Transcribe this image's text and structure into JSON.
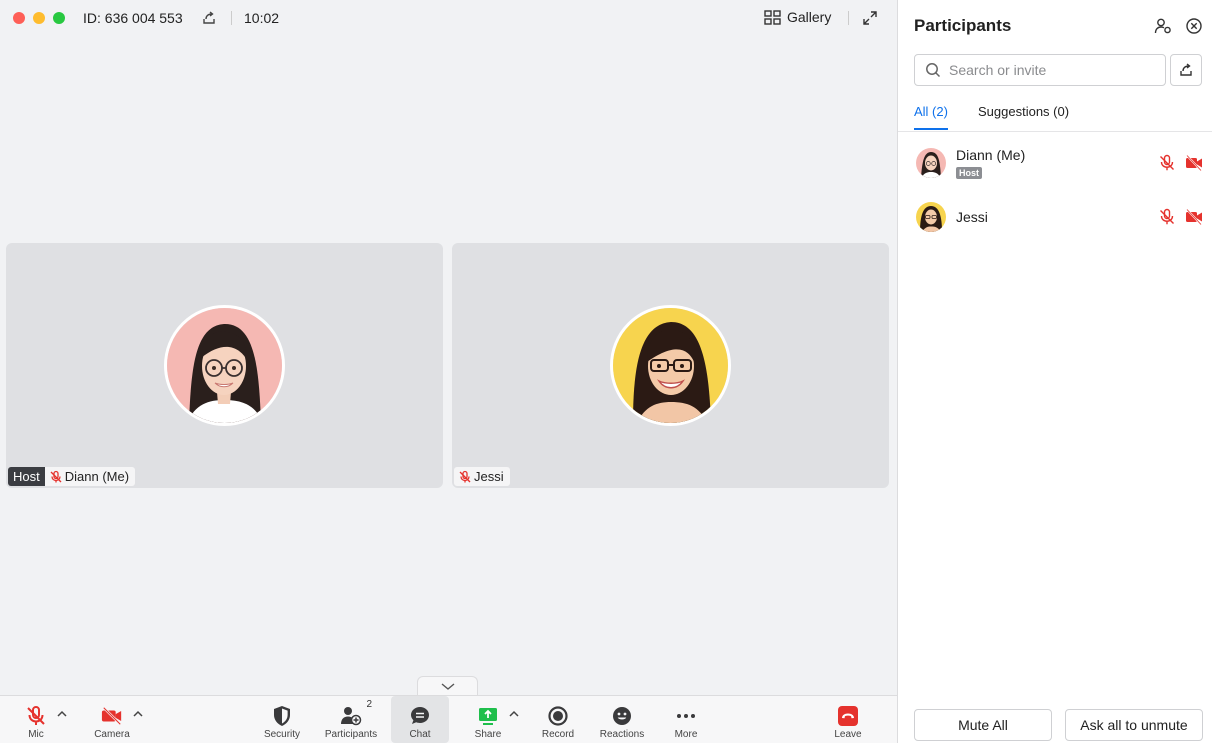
{
  "header": {
    "meeting_id": "ID: 636 004 553",
    "timer": "10:02",
    "view_label": "Gallery"
  },
  "tiles": [
    {
      "host_label": "Host",
      "name": "Diann (Me)"
    },
    {
      "name": "Jessi"
    }
  ],
  "toolbar": {
    "mic": "Mic",
    "camera": "Camera",
    "security": "Security",
    "participants": "Participants",
    "participants_count": "2",
    "chat": "Chat",
    "share": "Share",
    "record": "Record",
    "reactions": "Reactions",
    "more": "More",
    "leave": "Leave"
  },
  "panel": {
    "title": "Participants",
    "search_placeholder": "Search or invite",
    "tabs": [
      {
        "label": "All (2)",
        "active": true
      },
      {
        "label": "Suggestions (0)",
        "active": false
      }
    ],
    "participants": [
      {
        "name": "Diann (Me)",
        "badge": "Host",
        "mic": "muted",
        "camera": "off"
      },
      {
        "name": "Jessi",
        "mic": "muted",
        "camera": "off"
      }
    ],
    "mute_all": "Mute All",
    "ask_unmute": "Ask all to unmute"
  },
  "colors": {
    "accent": "#0e71eb",
    "danger": "#e5322d",
    "share_green": "#1fbf4c"
  }
}
